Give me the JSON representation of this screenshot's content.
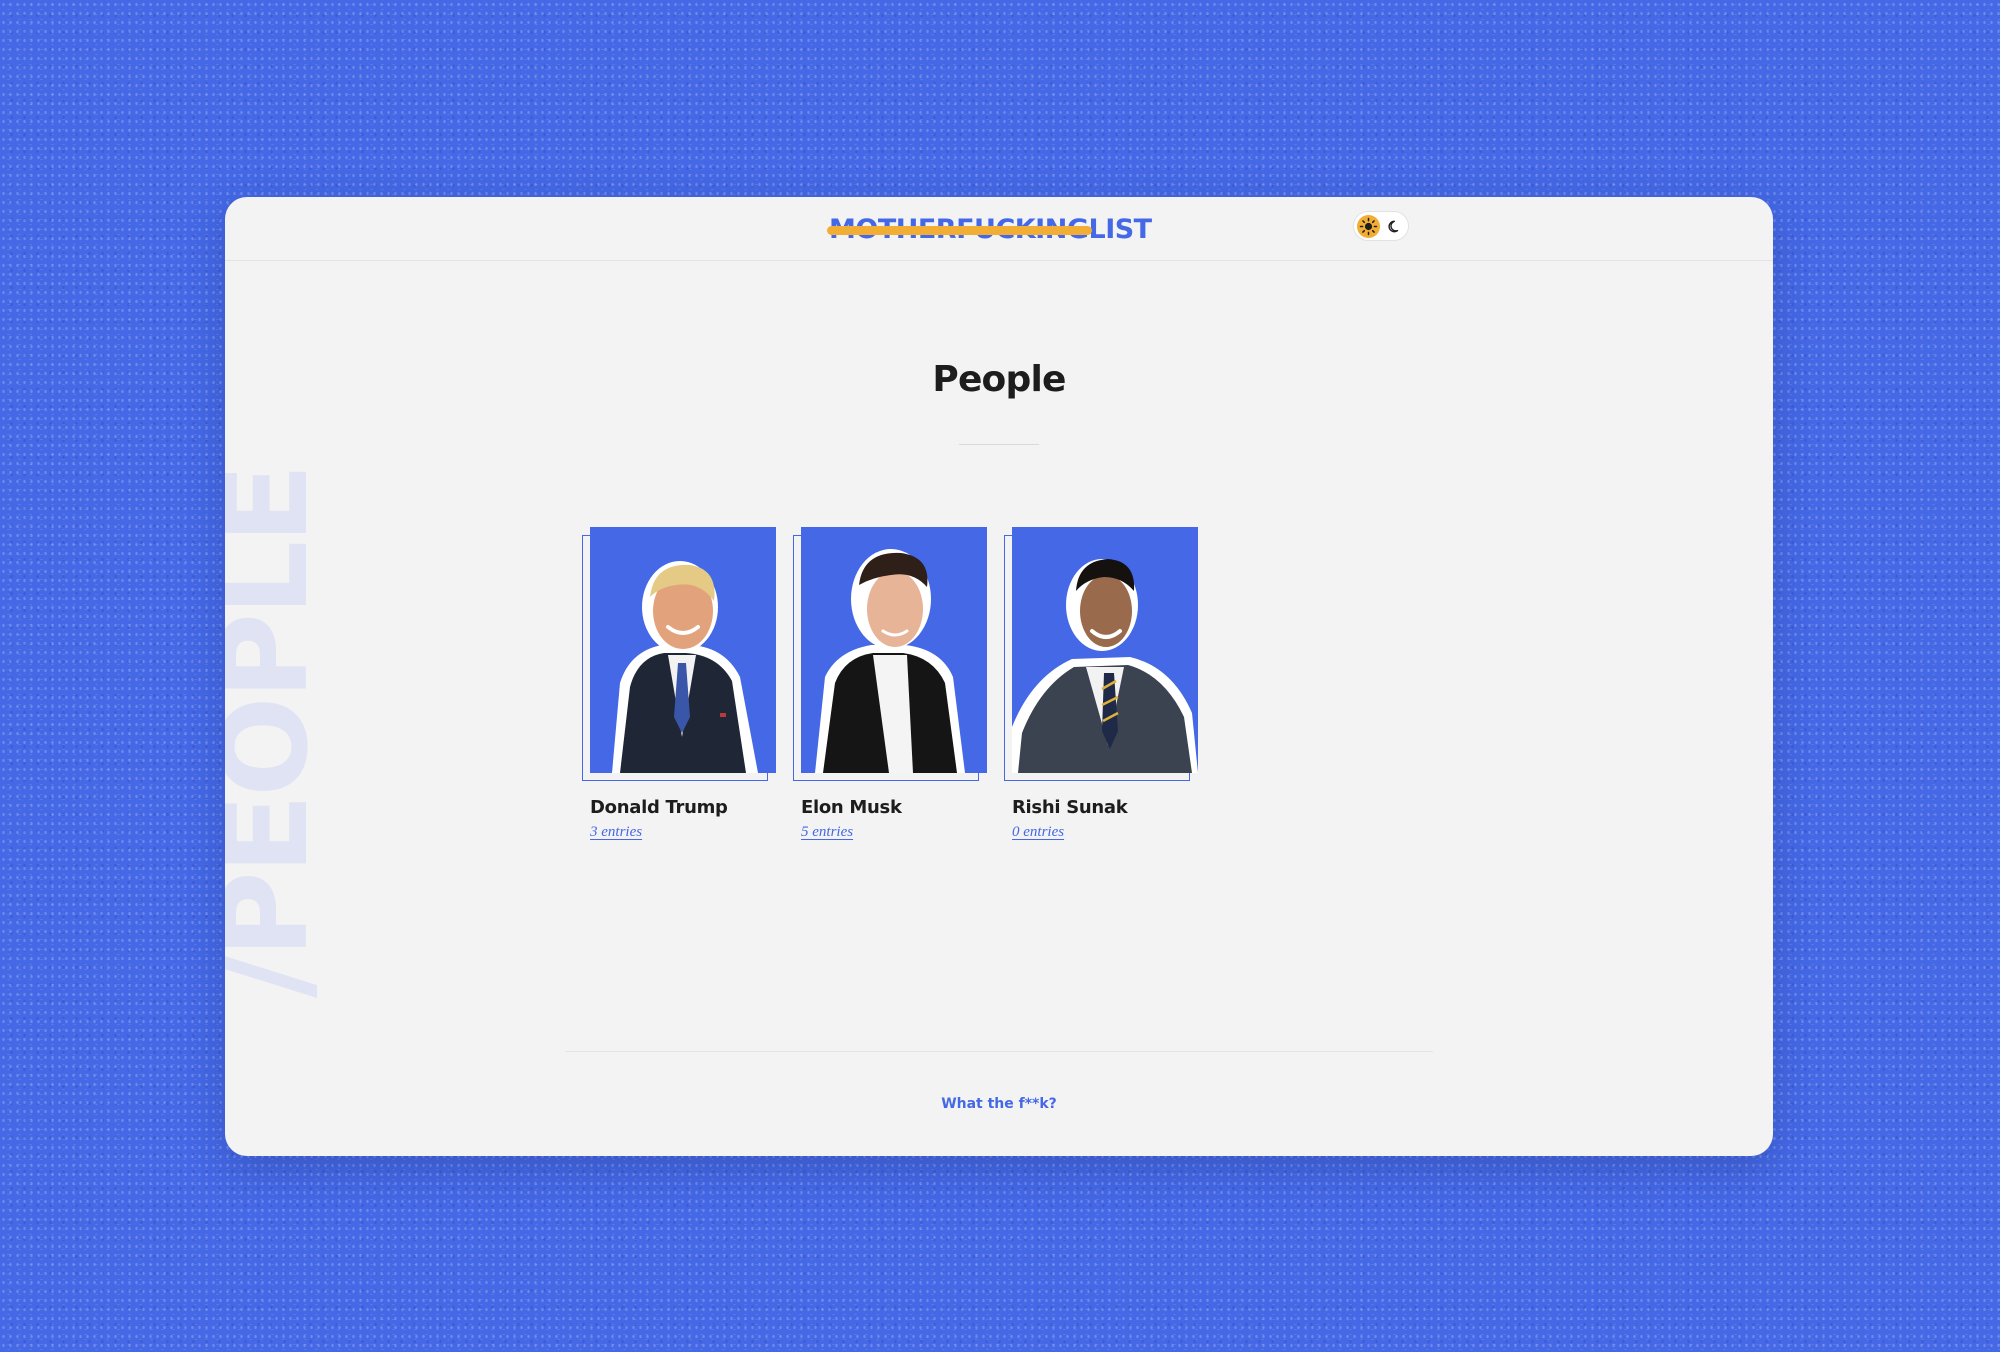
{
  "site": {
    "logo_struck": "MOTHERFUCKING",
    "logo_plain": "LIST",
    "background_word": "/PEOPLE"
  },
  "theme_toggle": {
    "selected": "light",
    "options": [
      "sun-icon",
      "moon-icon"
    ]
  },
  "page": {
    "title": "People"
  },
  "people": [
    {
      "name": "Donald Trump",
      "entries": "3 entries"
    },
    {
      "name": "Elon Musk",
      "entries": "5 entries"
    },
    {
      "name": "Rishi Sunak",
      "entries": "0 entries"
    }
  ],
  "footer": {
    "link": "What the f**k?"
  },
  "colors": {
    "brand_blue": "#4468e6",
    "accent_yellow": "#f2ad35",
    "card_background": "#f3f3f3",
    "text_dark": "#1d1d1d"
  }
}
